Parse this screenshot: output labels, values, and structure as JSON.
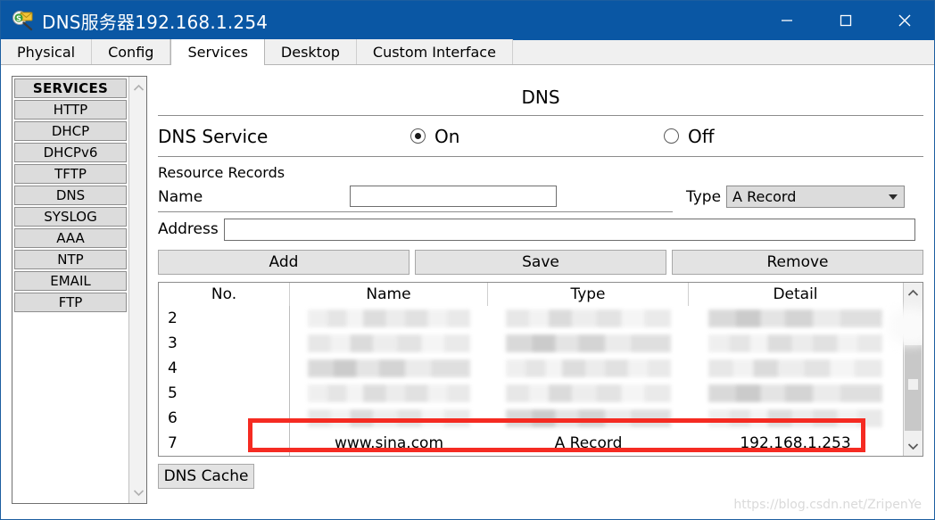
{
  "window": {
    "title": "DNS服务器192.168.1.254",
    "icon": "dns-server-icon",
    "minimize_label": "—",
    "maximize_label": "▢",
    "close_label": "✕"
  },
  "tabs": [
    {
      "label": "Physical",
      "active": false
    },
    {
      "label": "Config",
      "active": false
    },
    {
      "label": "Services",
      "active": true
    },
    {
      "label": "Desktop",
      "active": false
    },
    {
      "label": "Custom Interface",
      "active": false
    }
  ],
  "sidebar": {
    "header": "SERVICES",
    "items": [
      {
        "label": "HTTP"
      },
      {
        "label": "DHCP"
      },
      {
        "label": "DHCPv6"
      },
      {
        "label": "TFTP"
      },
      {
        "label": "DNS"
      },
      {
        "label": "SYSLOG"
      },
      {
        "label": "AAA"
      },
      {
        "label": "NTP"
      },
      {
        "label": "EMAIL"
      },
      {
        "label": "FTP"
      }
    ]
  },
  "panel": {
    "title": "DNS",
    "service_label": "DNS Service",
    "on_label": "On",
    "off_label": "Off",
    "service_state": "On",
    "resource_records_label": "Resource Records",
    "name_label": "Name",
    "name_value": "",
    "name_placeholder": "",
    "type_label": "Type",
    "type_value": "A Record",
    "address_label": "Address",
    "address_value": "",
    "address_placeholder": "",
    "buttons": {
      "add": "Add",
      "save": "Save",
      "remove": "Remove"
    },
    "cache_button": "DNS Cache"
  },
  "table": {
    "columns": [
      "No.",
      "Name",
      "Type",
      "Detail"
    ],
    "rows": [
      {
        "no": "2",
        "name": "",
        "type": "",
        "detail": "",
        "redacted": true,
        "highlighted": false
      },
      {
        "no": "3",
        "name": "",
        "type": "",
        "detail": "",
        "redacted": true,
        "highlighted": false
      },
      {
        "no": "4",
        "name": "",
        "type": "",
        "detail": "",
        "redacted": true,
        "highlighted": false
      },
      {
        "no": "5",
        "name": "",
        "type": "",
        "detail": "",
        "redacted": true,
        "highlighted": false
      },
      {
        "no": "6",
        "name": "",
        "type": "",
        "detail": "",
        "redacted": true,
        "highlighted": false
      },
      {
        "no": "7",
        "name": "www.sina.com",
        "type": "A Record",
        "detail": "192.168.1.253",
        "redacted": false,
        "highlighted": true
      }
    ],
    "scroll_up_label": "^",
    "scroll_down_label": "v"
  },
  "annotation": {
    "highlight_color": "#f52b22",
    "highlight_row_no": "7"
  },
  "watermark": "https://blog.csdn.net/ZripenYe",
  "colors": {
    "titlebar": "#0a57a4",
    "button_face": "#e3e3e3",
    "sidebar_item": "#dcdcdc",
    "accent_red": "#f52b22"
  }
}
